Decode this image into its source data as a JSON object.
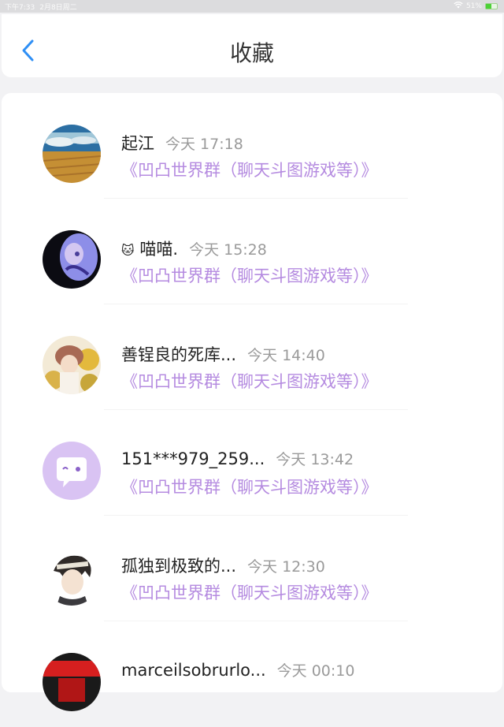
{
  "status_bar": {
    "time": "下午7:33",
    "date": "2月8日周二",
    "battery": "51%",
    "battery_level": 0.51
  },
  "header": {
    "title": "收藏"
  },
  "favorites": [
    {
      "name": "起江",
      "time": "今天 17:18",
      "group": "《凹凸世界群（聊天斗图游戏等）》"
    },
    {
      "name": "喵喵.",
      "time": "今天 15:28",
      "group": "《凹凸世界群（聊天斗图游戏等）》"
    },
    {
      "name": "善锃良的死库...",
      "time": "今天 14:40",
      "group": "《凹凸世界群（聊天斗图游戏等）》"
    },
    {
      "name": "151***979_259...",
      "time": "今天 13:42",
      "group": "《凹凸世界群（聊天斗图游戏等）》"
    },
    {
      "name": "孤独到极致的...",
      "time": "今天 12:30",
      "group": "《凹凸世界群（聊天斗图游戏等）》"
    },
    {
      "name": "marceilsobrurlo...",
      "time": "今天 00:10",
      "group": ""
    }
  ],
  "colors": {
    "accent": "#2f8ff5",
    "group_text": "#b58be0"
  }
}
